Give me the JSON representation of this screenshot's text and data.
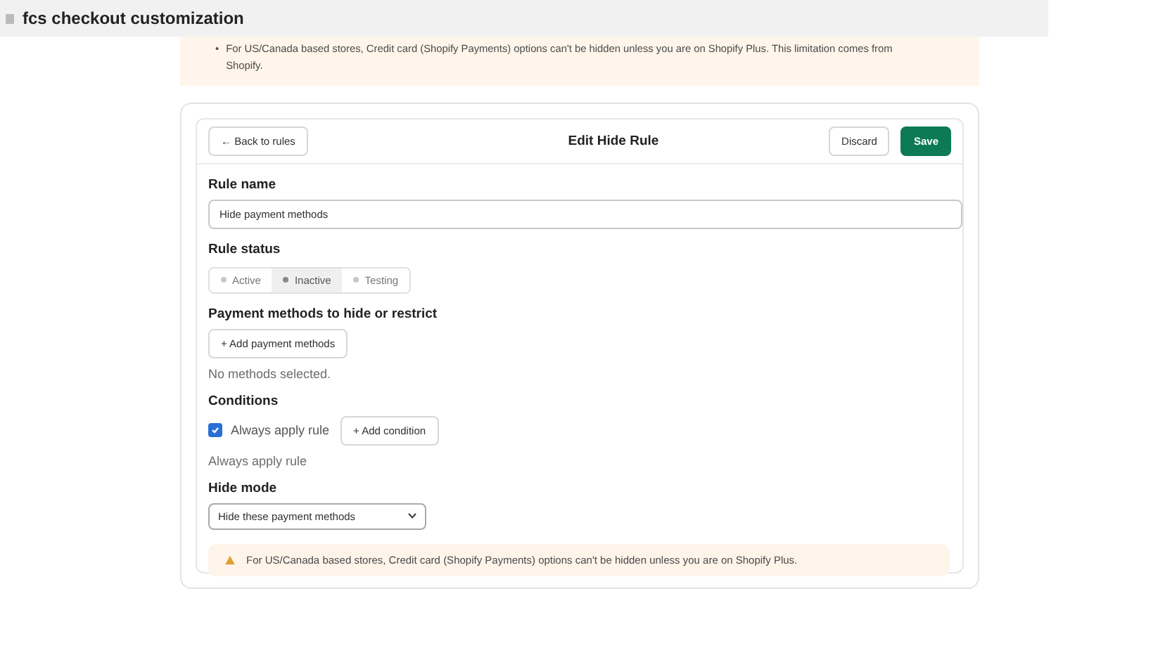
{
  "app_bar": {
    "title": "fcs checkout customization"
  },
  "top_notice": {
    "bullet": "•",
    "items": [
      "For US/Canada based stores, Credit card (Shopify Payments) options can't be hidden unless you are on Shopify Plus. This limitation comes from Shopify."
    ]
  },
  "header": {
    "back": "← Back to rules",
    "title": "Edit Hide Rule",
    "discard": "Discard",
    "save": "Save"
  },
  "rule_name": {
    "label": "Rule name",
    "value": "Hide payment methods"
  },
  "rule_status": {
    "label": "Rule status",
    "options": [
      {
        "label": "Active",
        "selected": false
      },
      {
        "label": "Inactive",
        "selected": true
      },
      {
        "label": "Testing",
        "selected": false
      }
    ]
  },
  "payment_methods": {
    "label": "Payment methods to hide or restrict",
    "button": "+ Add payment methods",
    "empty": "No methods selected."
  },
  "conditions": {
    "label": "Conditions",
    "checkbox": {
      "label": "Always apply rule",
      "checked": true
    },
    "button": "+ Add condition",
    "summary": "Always apply rule"
  },
  "hide_mode": {
    "label": "Hide mode",
    "value": "Hide these payment methods"
  },
  "warning": {
    "text": "For US/Canada based stores, Credit card (Shopify Payments) options can't be hidden unless you are on Shopify Plus."
  }
}
